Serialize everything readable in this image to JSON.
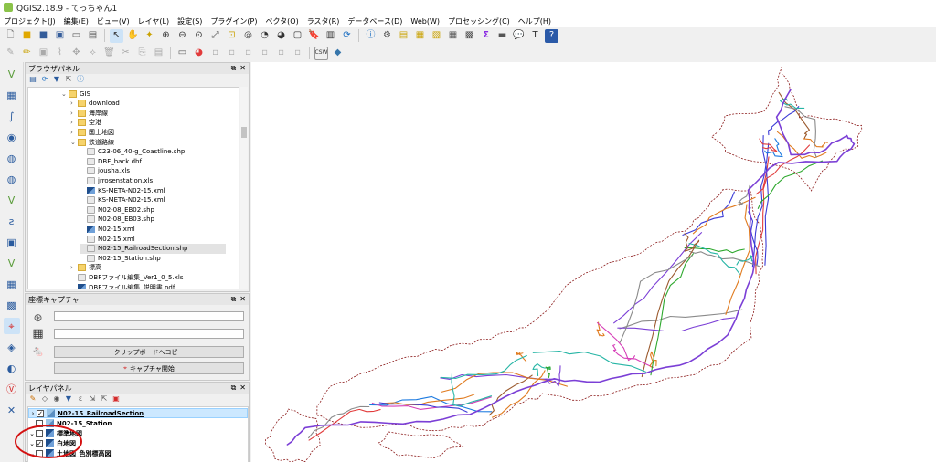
{
  "window": {
    "title": "QGIS2.18.9 - てっちゃん1"
  },
  "menu": [
    "プロジェクト(J)",
    "編集(E)",
    "ビュー(V)",
    "レイヤ(L)",
    "設定(S)",
    "プラグイン(P)",
    "ベクタ(O)",
    "ラスタ(R)",
    "データベース(D)",
    "Web(W)",
    "プロセッシング(C)",
    "ヘルプ(H)"
  ],
  "browser_panel": {
    "title": "ブラウザパネル",
    "items": [
      {
        "label": "GIS",
        "type": "folder",
        "indent": 0,
        "arrow": "⌄"
      },
      {
        "label": "download",
        "type": "folder",
        "indent": 1,
        "arrow": "›"
      },
      {
        "label": "海岸線",
        "type": "folder",
        "indent": 1,
        "arrow": "›"
      },
      {
        "label": "空港",
        "type": "folder",
        "indent": 1,
        "arrow": "›"
      },
      {
        "label": "国土地図",
        "type": "folder",
        "indent": 1,
        "arrow": "›"
      },
      {
        "label": "鉄道路線",
        "type": "folder",
        "indent": 1,
        "arrow": "⌄"
      },
      {
        "label": "C23-06_40-g_Coastline.shp",
        "type": "file",
        "indent": 2,
        "arrow": ""
      },
      {
        "label": "DBF_back.dbf",
        "type": "file",
        "indent": 2,
        "arrow": ""
      },
      {
        "label": "jousha.xls",
        "type": "file",
        "indent": 2,
        "arrow": ""
      },
      {
        "label": "jrrosenstation.xls",
        "type": "file",
        "indent": 2,
        "arrow": ""
      },
      {
        "label": "KS-META-N02-15.xml",
        "type": "layer",
        "indent": 2,
        "arrow": ""
      },
      {
        "label": "KS-META-N02-15.xml",
        "type": "file",
        "indent": 2,
        "arrow": ""
      },
      {
        "label": "N02-08_EB02.shp",
        "type": "file",
        "indent": 2,
        "arrow": ""
      },
      {
        "label": "N02-08_EB03.shp",
        "type": "file",
        "indent": 2,
        "arrow": ""
      },
      {
        "label": "N02-15.xml",
        "type": "layer",
        "indent": 2,
        "arrow": ""
      },
      {
        "label": "N02-15.xml",
        "type": "file",
        "indent": 2,
        "arrow": ""
      },
      {
        "label": "N02-15_RailroadSection.shp",
        "type": "file",
        "indent": 2,
        "arrow": "",
        "selected": true
      },
      {
        "label": "N02-15_Station.shp",
        "type": "file",
        "indent": 2,
        "arrow": ""
      },
      {
        "label": "標高",
        "type": "folder",
        "indent": 1,
        "arrow": "›"
      },
      {
        "label": "DBFファイル編集_Ver1_0_5.xls",
        "type": "file",
        "indent": 1,
        "arrow": ""
      },
      {
        "label": "DBFファイル編集_説明書.pdf",
        "type": "layer",
        "indent": 1,
        "arrow": ""
      }
    ]
  },
  "coord_panel": {
    "title": "座標キャプチャ",
    "clipboard_label": "クリップボードへコピー",
    "capture_label": "キャプチャ開始"
  },
  "layer_panel": {
    "title": "レイヤパネル",
    "layers": [
      {
        "label": "N02-15_RailroadSection",
        "arrow": "›",
        "checked": "✓",
        "selected": true
      },
      {
        "label": "N02-15_Station",
        "arrow": "",
        "checked": ""
      },
      {
        "label": "標準地図",
        "arrow": "⌄",
        "checked": ""
      },
      {
        "label": "白地図",
        "arrow": "⌄",
        "checked": "✓"
      },
      {
        "label": "土地図_色別標高図",
        "arrow": "⌄",
        "checked": ""
      }
    ]
  },
  "colors": {
    "highlight_ellipse": "#d41111",
    "selection": "#cce8ff"
  }
}
